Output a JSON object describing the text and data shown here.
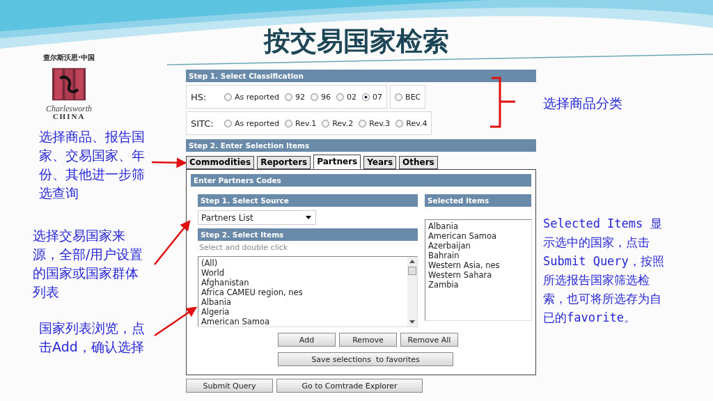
{
  "slide_title": "按交易国家检索",
  "logo": {
    "tagline": "查尔斯沃思·中国",
    "name": "Charlesworth",
    "country": "CHINA"
  },
  "form": {
    "classification": {
      "header": "Step 1. Select Classification",
      "groups": [
        {
          "label": "HS:",
          "options": [
            {
              "label": "As reported",
              "selected": false
            },
            {
              "label": "92",
              "selected": false
            },
            {
              "label": "96",
              "selected": false
            },
            {
              "label": "02",
              "selected": false
            },
            {
              "label": "07",
              "selected": true
            }
          ],
          "extra": [
            {
              "label": "BEC",
              "selected": false
            }
          ]
        },
        {
          "label": "SITC:",
          "options": [
            {
              "label": "As reported",
              "selected": false
            },
            {
              "label": "Rev.1",
              "selected": false
            },
            {
              "label": "Rev.2",
              "selected": false
            },
            {
              "label": "Rev.3",
              "selected": false
            },
            {
              "label": "Rev.4",
              "selected": false
            }
          ]
        }
      ]
    },
    "selection": {
      "header": "Step 2. Enter Selection Items",
      "tabs": [
        {
          "label": "Commodities",
          "selected": false
        },
        {
          "label": "Reporters",
          "selected": false
        },
        {
          "label": "Partners",
          "selected": true
        },
        {
          "label": "Years",
          "selected": false
        },
        {
          "label": "Others",
          "selected": false
        }
      ],
      "panel": {
        "header": "Enter Partners Codes",
        "source": {
          "header": "Step 1. Select Source",
          "value": "Partners List"
        },
        "items": {
          "header": "Step 2. Select Items",
          "hint": "Select and double click",
          "list": [
            "(All)",
            "World",
            "Afghanistan",
            "Africa CAMEU region, nes",
            "Albania",
            "Algeria",
            "American Samoa"
          ]
        },
        "selected": {
          "header": "Selected Items",
          "list": [
            "Albania",
            "American Samoa",
            "Azerbaijan",
            "Bahrain",
            "Western Asia, nes",
            "Western Sahara",
            "Zambia"
          ]
        },
        "buttons": [
          "Add",
          "Remove",
          "Remove All"
        ],
        "save_button": "Save selections  to favorites"
      }
    },
    "actions": [
      "Submit Query",
      "Go to Comtrade Explorer"
    ]
  },
  "left_notes": [
    "选择商品、报告国家、交易国家、年份、其他进一步筛选查询",
    "选择交易国家来源，全部/用户设置的国家或国家群体列表",
    "国家列表浏览，点击Add，确认选择"
  ],
  "right_notes": [
    "选择商品分类",
    "Selected Items 显示选中的国家，点击Submit Query，按照所选报告国家筛选检索，也可将所选存为自已的favorite。"
  ]
}
